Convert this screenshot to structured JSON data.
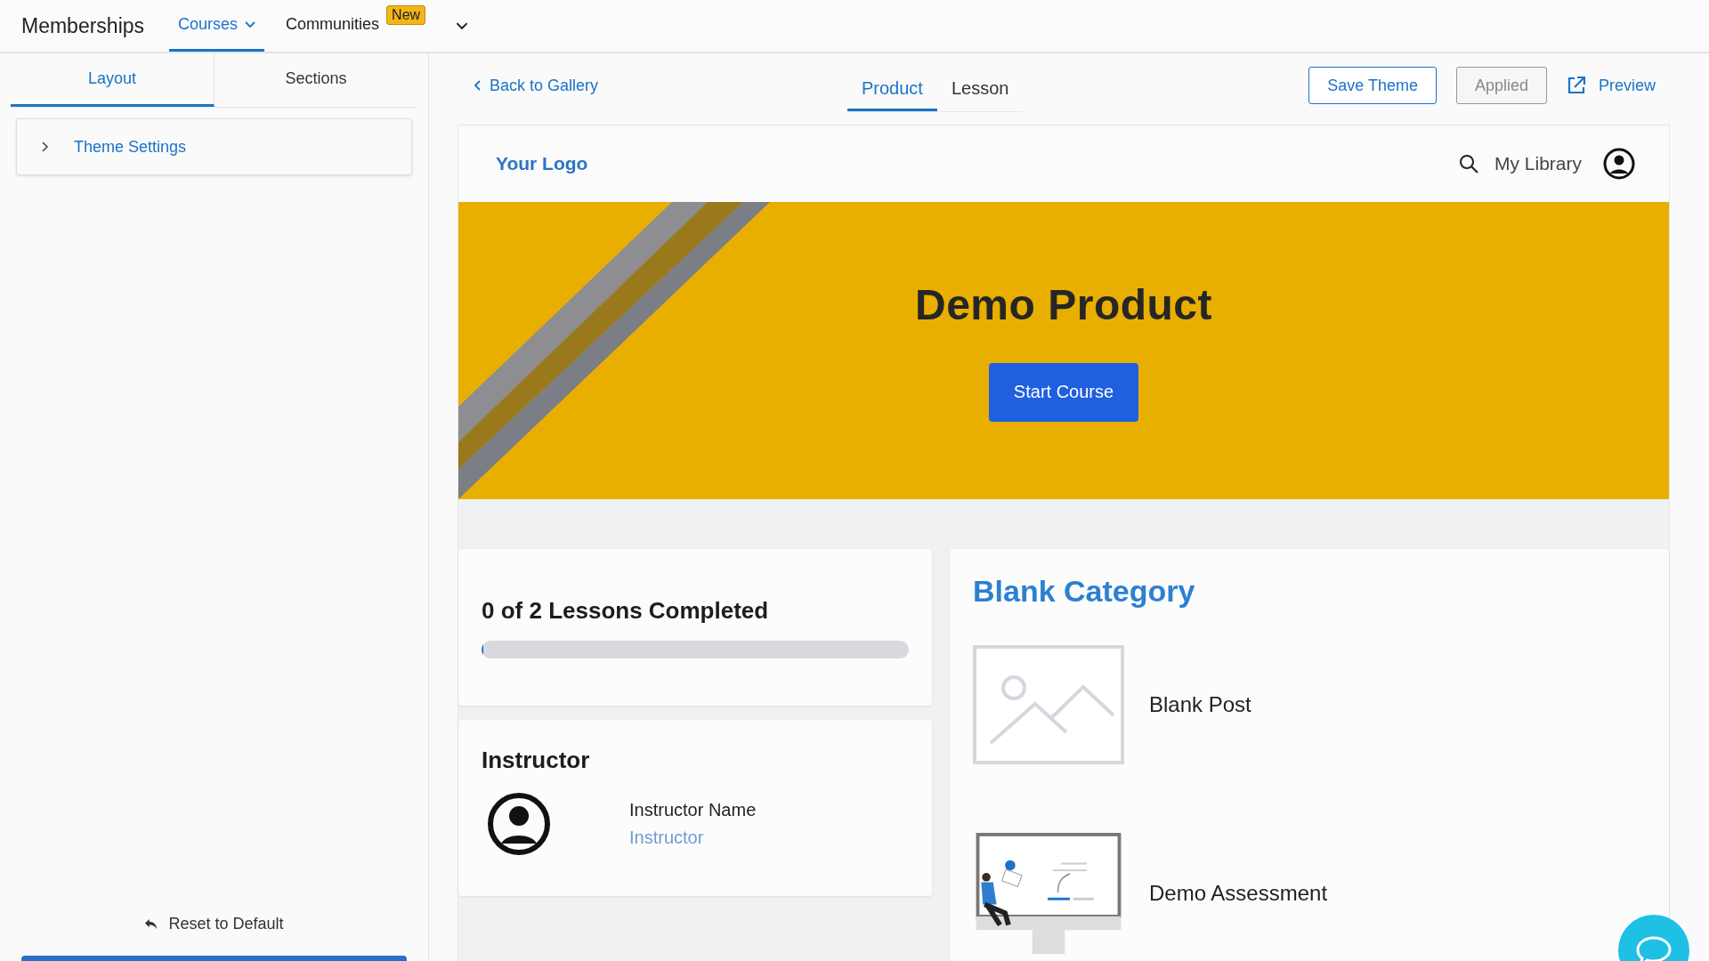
{
  "app": {
    "title": "Memberships",
    "nav": [
      {
        "label": "Courses",
        "selected": true,
        "dropdown": true
      },
      {
        "label": "Communities",
        "selected": false,
        "dropdown": false,
        "badge": "New"
      }
    ]
  },
  "sidebar": {
    "tabs": [
      {
        "label": "Layout",
        "selected": true
      },
      {
        "label": "Sections",
        "selected": false
      }
    ],
    "items": [
      {
        "label": "Theme Settings",
        "expanded": false
      }
    ],
    "reset": "Reset to Default"
  },
  "editor": {
    "back": "Back to Gallery",
    "view_tabs": [
      {
        "label": "Product",
        "selected": true
      },
      {
        "label": "Lesson",
        "selected": false
      }
    ],
    "buttons": [
      {
        "label": "Save Theme",
        "kind": "primary"
      },
      {
        "label": "Applied",
        "kind": "disabled"
      }
    ],
    "preview": "Preview"
  },
  "preview": {
    "logo": "Your Logo",
    "library": "My Library",
    "hero": {
      "title": "Demo Product",
      "button": "Start Course"
    },
    "progress": {
      "title": "0 of 2 Lessons Completed",
      "level": 0
    },
    "instructor": {
      "heading": "Instructor",
      "name": "Instructor Name",
      "role": "Instructor"
    },
    "category": {
      "title": "Blank Category",
      "posts": [
        {
          "title": "Blank Post",
          "kind": "blank"
        },
        {
          "title": "Demo Assessment",
          "kind": "assessment"
        }
      ]
    }
  }
}
